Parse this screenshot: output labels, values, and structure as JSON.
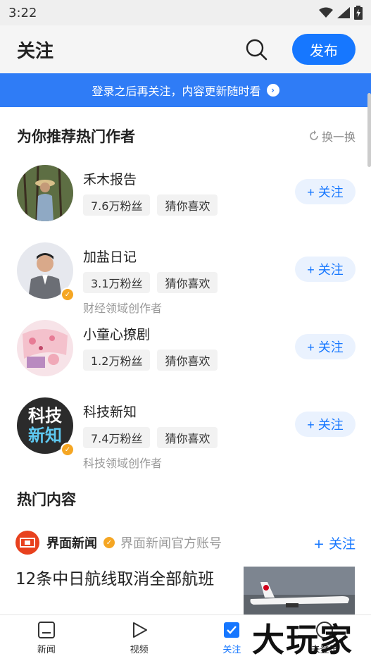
{
  "status": {
    "time": "3:22"
  },
  "header": {
    "title": "关注",
    "publish_label": "发布"
  },
  "banner": {
    "text": "登录之后再关注，内容更新随时看"
  },
  "recommend": {
    "title": "为你推荐热门作者",
    "refresh_label": "换一换",
    "authors": [
      {
        "name": "禾木报告",
        "fans": "7.6万粉丝",
        "tag": "猜你喜欢",
        "desc": "",
        "verified": false,
        "follow": "+ 关注"
      },
      {
        "name": "加盐日记",
        "fans": "3.1万粉丝",
        "tag": "猜你喜欢",
        "desc": "财经领域创作者",
        "verified": true,
        "follow": "+ 关注"
      },
      {
        "name": "小童心撩剧",
        "fans": "1.2万粉丝",
        "tag": "猜你喜欢",
        "desc": "",
        "verified": false,
        "follow": "+ 关注"
      },
      {
        "name": "科技新知",
        "fans": "7.4万粉丝",
        "tag": "猜你喜欢",
        "desc": "科技领域创作者",
        "verified": true,
        "follow": "+ 关注",
        "avatar_text": [
          "科技",
          "新知"
        ]
      }
    ]
  },
  "hot": {
    "title": "热门内容",
    "post": {
      "source_name": "界面新闻",
      "source_desc": "界面新闻官方账号",
      "follow": "+ 关注",
      "title": "12条中日航线取消全部航班"
    }
  },
  "nav": {
    "items": [
      {
        "label": "新闻"
      },
      {
        "label": "视频"
      },
      {
        "label": "关注"
      },
      {
        "label": "未登录"
      }
    ]
  },
  "watermark": "大玩家",
  "colors": {
    "accent": "#1677ff",
    "banner": "#2f7cf6",
    "verified": "#f5a623"
  }
}
